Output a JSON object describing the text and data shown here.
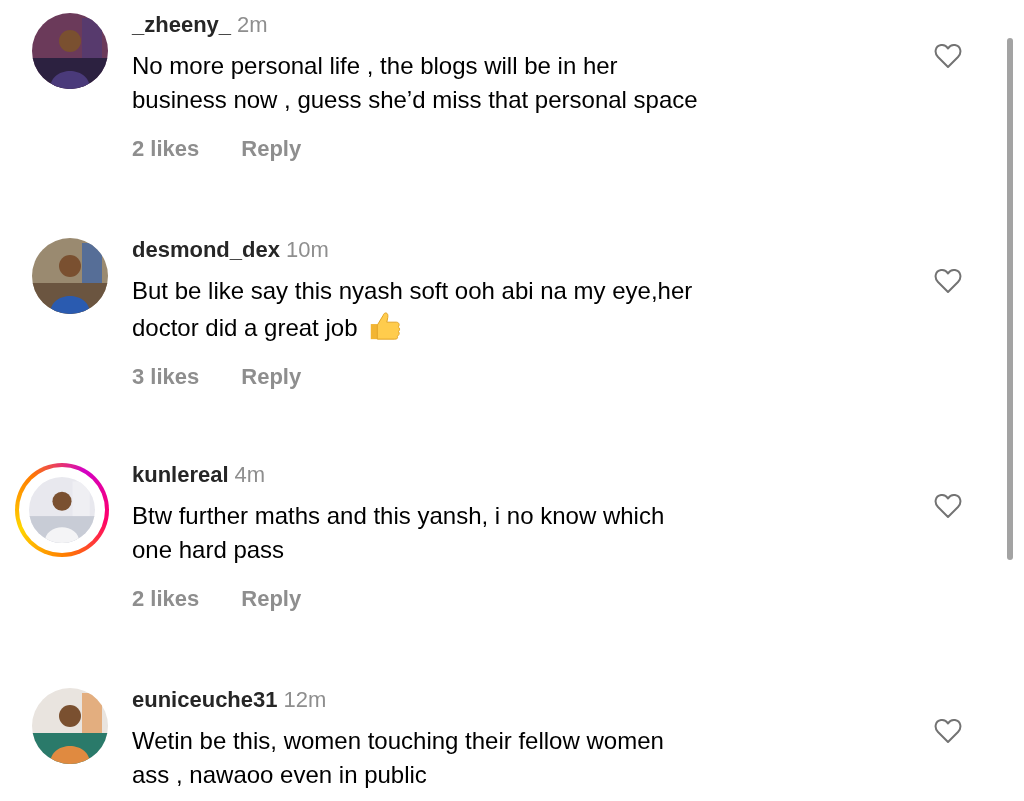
{
  "comments": [
    {
      "username": "_zheeny_",
      "time": "2m",
      "story_ring": false,
      "lines": [
        "No more personal life , the blogs will be in her",
        "business now , guess she’d miss that personal space"
      ],
      "has_emoji": false,
      "likes": "2 likes",
      "reply": "Reply",
      "liked": false
    },
    {
      "username": "desmond_dex",
      "time": "10m",
      "story_ring": false,
      "lines": [
        "But be like say this nyash soft ooh abi na my eye,her",
        "doctor did a great job"
      ],
      "has_emoji": true,
      "likes": "3 likes",
      "reply": "Reply",
      "liked": false
    },
    {
      "username": "kunlereal",
      "time": "4m",
      "story_ring": true,
      "lines": [
        "Btw further maths and this yansh, i no know which",
        "one hard pass"
      ],
      "has_emoji": false,
      "likes": "2 likes",
      "reply": "Reply",
      "liked": false
    },
    {
      "username": "euniceuche31",
      "time": "12m",
      "story_ring": false,
      "lines": [
        "Wetin be this, women touching their fellow women",
        "ass , nawaoo even in public"
      ],
      "has_emoji": false,
      "liked": false
    }
  ]
}
